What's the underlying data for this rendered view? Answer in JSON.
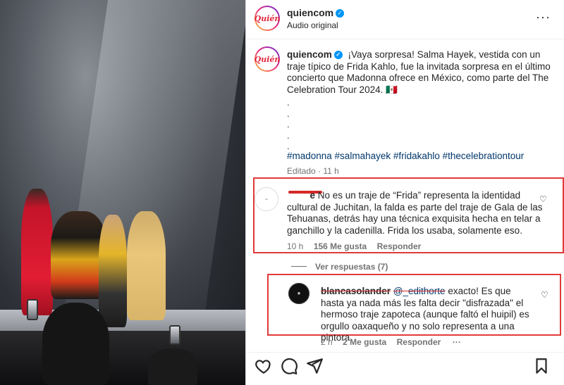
{
  "post": {
    "username": "quiencom",
    "audio": "Audio original",
    "more_icon": "more-horizontal-icon",
    "avatar_text": "Quién"
  },
  "caption": {
    "username": "quiencom",
    "text": "¡Vaya sorpresa! Salma Hayek, vestida con un traje típico de Frida Kahlo, fue la invitada sorpresa en el último concierto que Madonna ofrece en México, como parte del The Celebration Tour 2024. 🇲🇽",
    "dots": [
      ".",
      ".",
      ".",
      ".",
      "."
    ],
    "hashtags": "#madonna #salmahayek #fridakahlo #thecelebrationtour",
    "edited": "Editado · 11 h"
  },
  "comments": [
    {
      "username_suffix": "e",
      "text": "No es un traje de “Frida” representa la identidad cultural de Juchitan, la falda es parte del traje de Gala de las Tehuanas, detrás hay una técnica exquisita hecha en telar a ganchillo y la cadenilla. Frida los usaba, solamente eso.",
      "time": "10 h",
      "likes": "156 Me gusta",
      "reply": "Responder"
    }
  ],
  "view_replies": "Ver respuestas (7)",
  "reply": {
    "username": "blancasolander",
    "mention": "@_edithorte",
    "text": "exacto! Es que hasta ya nada más les falta decir \"disfrazada\" el hermoso traje zapoteca (aunque faltó el huipil) es orgullo oaxaqueño y no solo representa a una pintora",
    "time": "2 h",
    "likes": "2 Me gusta",
    "reply": "Responder",
    "more": "···"
  },
  "colors": {
    "highlight_box": "#e03a3a",
    "hashtag": "#00376b",
    "verified": "#0095f6",
    "meta": "#737373"
  }
}
